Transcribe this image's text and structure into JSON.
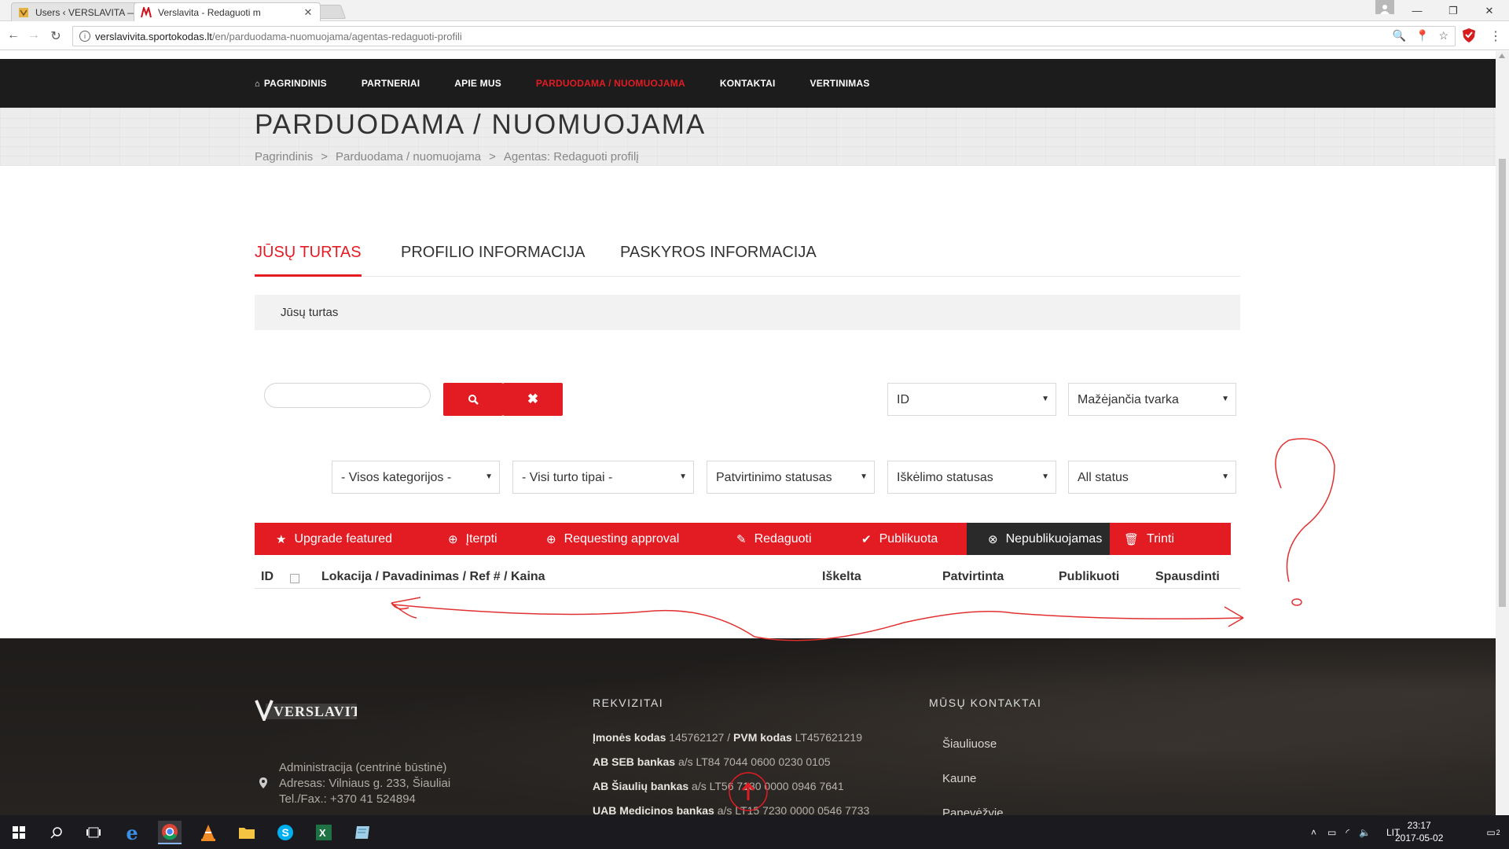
{
  "browser": {
    "tabs": [
      {
        "title": "Users ‹ VERSLAVITA — Ad",
        "active": false
      },
      {
        "title": "Verslavita - Redaguoti m",
        "active": true
      }
    ],
    "url_host": "verslavivita.sportokodas.lt",
    "url_path": "/en/parduodama-nuomuojama/agentas-redaguoti-profili"
  },
  "nav": {
    "items": [
      "PAGRINDINIS",
      "PARTNERIAI",
      "APIE MUS",
      "PARDUODAMA / NUOMUOJAMA",
      "KONTAKTAI",
      "VERTINIMAS"
    ],
    "active_index": 3
  },
  "header": {
    "title": "PARDUODAMA / NUOMUOJAMA",
    "breadcrumb": [
      "Pagrindinis",
      "Parduodama / nuomuojama",
      "Agentas: Redaguoti profilį"
    ]
  },
  "tabs": [
    "JŪSŲ TURTAS",
    "PROFILIO INFORMACIJA",
    "PASKYROS INFORMACIJA"
  ],
  "panel_title": "Jūsų turtas",
  "search": {
    "value": "",
    "placeholder": ""
  },
  "sort": {
    "field": "ID",
    "order": "Mažėjančia tvarka"
  },
  "filters": [
    "- Visos kategorijos -",
    "- Visi turto tipai -",
    "Patvirtinimo statusas",
    "Iškėlimo statusas",
    "All status"
  ],
  "actions": [
    {
      "label": "Upgrade featured",
      "icon": "star-icon"
    },
    {
      "label": "Įterpti",
      "icon": "plus-circle-icon"
    },
    {
      "label": "Requesting approval",
      "icon": "globe-icon"
    },
    {
      "label": "Redaguoti",
      "icon": "edit-icon"
    },
    {
      "label": "Publikuota",
      "icon": "check-icon"
    },
    {
      "label": "Nepublikuojamas",
      "icon": "x-circle-icon"
    },
    {
      "label": "Trinti",
      "icon": "trash-icon"
    }
  ],
  "table_headers": [
    "ID",
    "Lokacija / Pavadinimas / Ref # / Kaina",
    "Iškelta",
    "Patvirtinta",
    "Publikuoti",
    "Spausdinti"
  ],
  "footer": {
    "logo_text": "VERSLAVITA",
    "address": [
      "Administracija (centrinė būstinė)",
      "Adresas: Vilniaus g. 233, Šiauliai",
      "Tel./Fax.: +370 41 524894"
    ],
    "rekvizitai_title": "REKVIZITAI",
    "rekvizitai": [
      {
        "label": "Įmonės kodas",
        "value": "145762127",
        "label2": "PVM kodas",
        "value2": "LT457621219"
      },
      {
        "label": "AB SEB bankas",
        "value": "a/s LT84 7044 0600 0230 0105"
      },
      {
        "label": "AB Šiaulių bankas",
        "value": "a/s LT56 7180 0000 0946 7641"
      },
      {
        "label": "UAB Medicinos bankas",
        "value": "a/s LT15 7230 0000 0546 7733"
      }
    ],
    "contacts_title": "MŪSŲ KONTAKTAI",
    "contacts": [
      "Šiauliuose",
      "Kaune",
      "Panevėžyje"
    ]
  },
  "taskbar": {
    "time": "23:17",
    "date": "2017-05-02",
    "lang": "LIT",
    "notif_count": "2"
  },
  "colors": {
    "accent": "#e31b23",
    "nav_bg": "#1c1c1c",
    "footer_bg": "#262321"
  }
}
